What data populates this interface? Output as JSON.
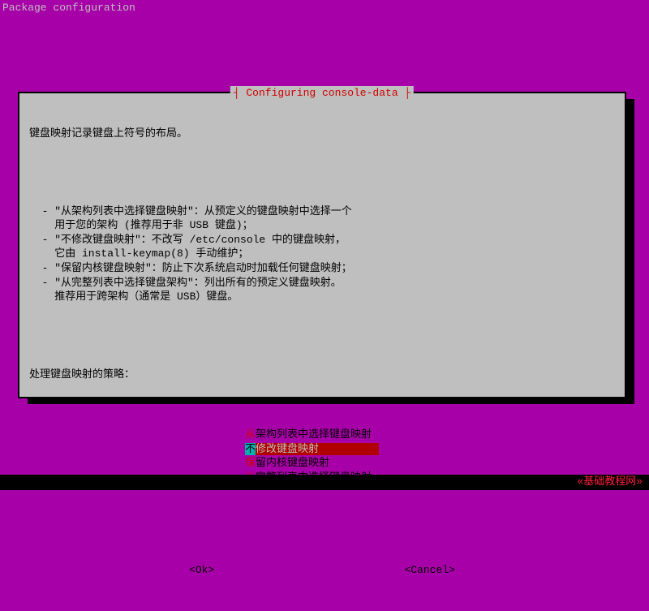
{
  "screen": {
    "title": "Package configuration"
  },
  "dialog": {
    "title": "┤ Configuring console-data ├",
    "intro": "键盘映射记录键盘上符号的布局。",
    "desc": "  - \"从架构列表中选择键盘映射\"：从预定义的键盘映射中选择一个\n    用于您的架构 (推荐用于非 USB 键盘)；\n  - \"不修改键盘映射\"：不改写 /etc/console 中的键盘映射，\n    它由 install-keymap(8) 手动维护；\n  - \"保留内核键盘映射\"：防止下次系统启动时加载任何键盘映射；\n  - \"从完整列表中选择键盘架构\"：列出所有的预定义键盘映射。\n    推荐用于跨架构（通常是 USB）键盘。",
    "prompt": "处理键盘映射的策略：",
    "options": [
      {
        "label": "从架构列表中选择键盘映射",
        "selected": false
      },
      {
        "label": "不修改键盘映射",
        "selected": true
      },
      {
        "label": "保留内核键盘映射",
        "selected": false
      },
      {
        "label": "从完整列表中选择键盘映射",
        "selected": false
      }
    ],
    "selected_prefix": "不",
    "selected_main": "修改键盘映射",
    "buttons": {
      "ok": "<Ok>",
      "cancel": "<Cancel>"
    }
  },
  "footer": {
    "label": "«基础教程网»"
  }
}
